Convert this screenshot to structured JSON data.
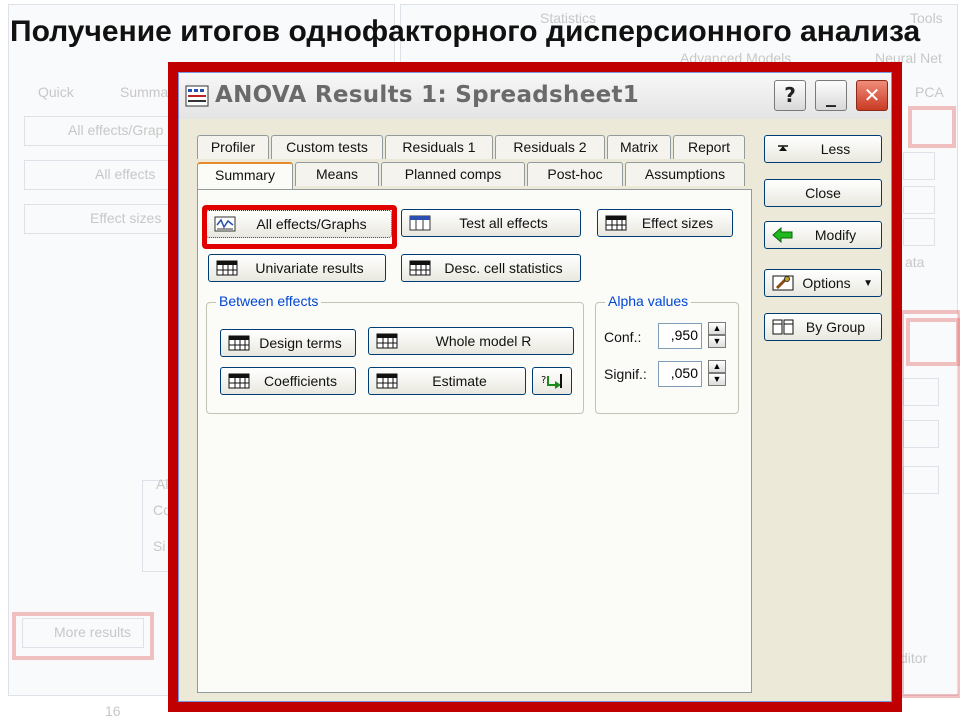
{
  "slide": {
    "title": "Получение итогов однофакторного дисперсионного анализа"
  },
  "background_app": {
    "menu_tools": "Tools",
    "menu_statistics": "Statistics",
    "menu_neural": "Neural Net",
    "tab_quick": "Quick",
    "tab_summary": "Summa",
    "items": [
      "All effects/Grap",
      "All effects",
      "Effect sizes"
    ],
    "more_results": "More results",
    "pca": "PCA",
    "data_label": "ata",
    "row_number": "16",
    "group_label": "Al",
    "row_co": "Co",
    "row_si": "Si",
    "editor": "ditor",
    "advanced": "Advanced Models"
  },
  "dialog": {
    "title": "ANOVA Results 1: Spreadsheet1",
    "help_symbol": "?",
    "minimize_symbol": "_",
    "close_symbol": "✕",
    "tabs_row1": [
      "Profiler",
      "Custom tests",
      "Residuals 1",
      "Residuals 2",
      "Matrix",
      "Report"
    ],
    "tabs_row2": [
      "Summary",
      "Means",
      "Planned comps",
      "Post-hoc",
      "Assumptions"
    ],
    "active_tab": "Summary",
    "buttons": {
      "all_effects": "All effects/Graphs",
      "test_all": "Test all effects",
      "effect_sizes": "Effect sizes",
      "univariate": "Univariate results",
      "desc_cell": "Desc. cell statistics",
      "design_terms": "Design terms",
      "whole_model": "Whole model R",
      "coefficients": "Coefficients",
      "estimate": "Estimate"
    },
    "between_effects_label": "Between effects",
    "alpha": {
      "label": "Alpha values",
      "conf_label": "Conf.:",
      "conf_value": ",950",
      "signif_label": "Signif.:",
      "signif_value": ",050"
    },
    "side": {
      "less": "Less",
      "close": "Close",
      "modify": "Modify",
      "options": "Options",
      "by_group": "By Group"
    }
  },
  "colors": {
    "frame_red": "#c00000",
    "highlight_red": "#e00000",
    "group_label_blue": "#0046d5",
    "panel_bg": "#ece9d8"
  }
}
